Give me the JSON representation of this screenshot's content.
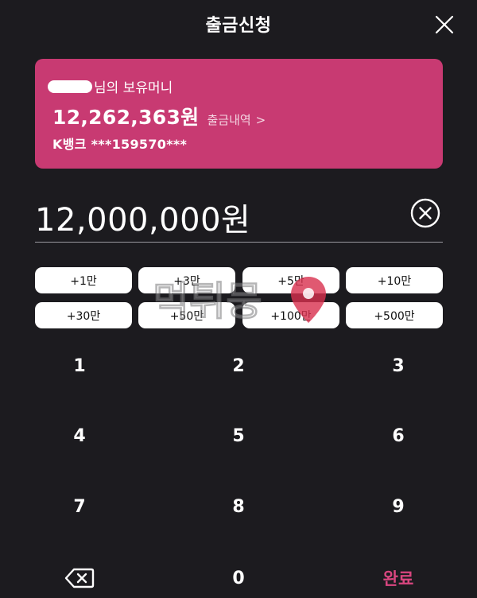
{
  "header": {
    "title": "출금신청",
    "close_icon": "close-icon"
  },
  "card": {
    "owner_suffix": "님의 보유머니",
    "balance": "12,262,363원",
    "history_label": "출금내역",
    "history_chevron": ">",
    "bank": "K뱅크 ***159570***",
    "color": "#c83a72"
  },
  "amount": {
    "value": "12,000,000원",
    "clear_icon": "clear-circle-icon"
  },
  "quick_amounts": [
    "+1만",
    "+3만",
    "+5만",
    "+10만",
    "+30만",
    "+50만",
    "+100만",
    "+500만"
  ],
  "watermark": {
    "text": "먹튀뭉",
    "icon": "map-pin-icon"
  },
  "keypad": {
    "keys": [
      "1",
      "2",
      "3",
      "4",
      "5",
      "6",
      "7",
      "8",
      "9"
    ],
    "zero": "0",
    "backspace_icon": "backspace-icon",
    "done_label": "완료",
    "done_color": "#d9467f"
  }
}
